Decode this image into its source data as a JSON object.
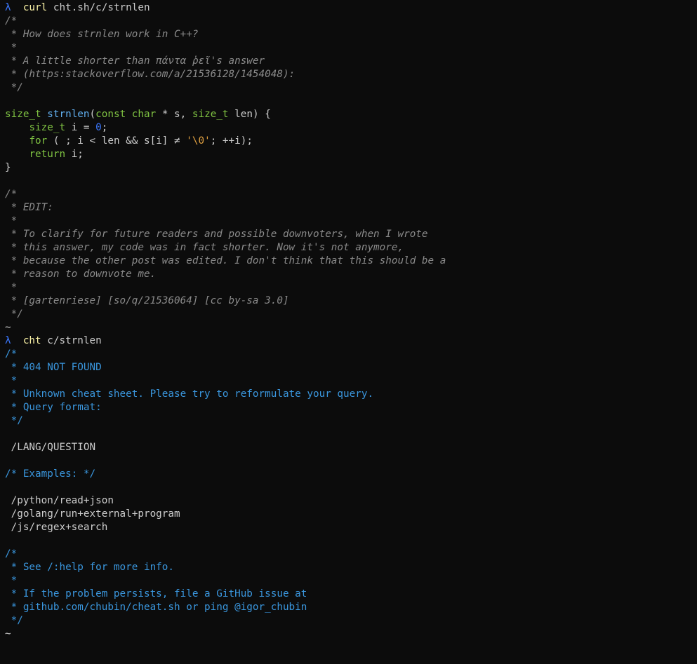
{
  "window": {
    "background": "#0c0c0c",
    "prompt_color": "#3b78ff",
    "command_color": "#f9f1a5",
    "comment_color": "#8a8a8a",
    "error_color": "#3a96dd"
  },
  "terminal": {
    "lines": [
      {
        "t": "prompt",
        "segments": [
          {
            "c": "prompt-sym",
            "x": "λ  "
          },
          {
            "c": "cmd",
            "x": "curl"
          },
          {
            "c": "arg",
            "x": " cht.sh/c/strnlen"
          }
        ]
      },
      {
        "t": "text",
        "segments": [
          {
            "c": "cmt",
            "x": "/*"
          }
        ]
      },
      {
        "t": "text",
        "segments": [
          {
            "c": "cmt",
            "x": " * How does strnlen work in C++?"
          }
        ]
      },
      {
        "t": "text",
        "segments": [
          {
            "c": "cmt",
            "x": " *"
          }
        ]
      },
      {
        "t": "text",
        "segments": [
          {
            "c": "cmt",
            "x": " * A little shorter than πάντα ῥεῖ's answer"
          }
        ]
      },
      {
        "t": "text",
        "segments": [
          {
            "c": "cmt",
            "x": " * (https:stackoverflow.com/a/21536128/1454048):"
          }
        ]
      },
      {
        "t": "text",
        "segments": [
          {
            "c": "cmt",
            "x": " */"
          }
        ]
      },
      {
        "t": "text",
        "segments": [
          {
            "c": "plain",
            "x": ""
          }
        ]
      },
      {
        "t": "code",
        "segments": [
          {
            "c": "type",
            "x": "size_t"
          },
          {
            "c": "plain",
            "x": " "
          },
          {
            "c": "fn",
            "x": "strnlen"
          },
          {
            "c": "plain",
            "x": "("
          },
          {
            "c": "kw",
            "x": "const"
          },
          {
            "c": "plain",
            "x": " "
          },
          {
            "c": "kw",
            "x": "char"
          },
          {
            "c": "plain",
            "x": " * s, "
          },
          {
            "c": "type",
            "x": "size_t"
          },
          {
            "c": "plain",
            "x": " len) {"
          }
        ]
      },
      {
        "t": "code",
        "segments": [
          {
            "c": "plain",
            "x": "    "
          },
          {
            "c": "type",
            "x": "size_t"
          },
          {
            "c": "plain",
            "x": " i = "
          },
          {
            "c": "num",
            "x": "0"
          },
          {
            "c": "plain",
            "x": ";"
          }
        ]
      },
      {
        "t": "code",
        "segments": [
          {
            "c": "plain",
            "x": "    "
          },
          {
            "c": "kw",
            "x": "for"
          },
          {
            "c": "plain",
            "x": " ( ; i < len && s[i] ≠ "
          },
          {
            "c": "str",
            "x": "'\\0'"
          },
          {
            "c": "plain",
            "x": "; ++i);"
          }
        ]
      },
      {
        "t": "code",
        "segments": [
          {
            "c": "plain",
            "x": "    "
          },
          {
            "c": "kw",
            "x": "return"
          },
          {
            "c": "plain",
            "x": " i;"
          }
        ]
      },
      {
        "t": "code",
        "segments": [
          {
            "c": "plain",
            "x": "}"
          }
        ]
      },
      {
        "t": "text",
        "segments": [
          {
            "c": "plain",
            "x": ""
          }
        ]
      },
      {
        "t": "text",
        "segments": [
          {
            "c": "cmt",
            "x": "/*"
          }
        ]
      },
      {
        "t": "text",
        "segments": [
          {
            "c": "cmt",
            "x": " * EDIT:"
          }
        ]
      },
      {
        "t": "text",
        "segments": [
          {
            "c": "cmt",
            "x": " *"
          }
        ]
      },
      {
        "t": "text",
        "segments": [
          {
            "c": "cmt",
            "x": " * To clarify for future readers and possible downvoters, when I wrote"
          }
        ]
      },
      {
        "t": "text",
        "segments": [
          {
            "c": "cmt",
            "x": " * this answer, my code was in fact shorter. Now it's not anymore,"
          }
        ]
      },
      {
        "t": "text",
        "segments": [
          {
            "c": "cmt",
            "x": " * because the other post was edited. I don't think that this should be a"
          }
        ]
      },
      {
        "t": "text",
        "segments": [
          {
            "c": "cmt",
            "x": " * reason to downvote me."
          }
        ]
      },
      {
        "t": "text",
        "segments": [
          {
            "c": "cmt",
            "x": " *"
          }
        ]
      },
      {
        "t": "text",
        "segments": [
          {
            "c": "cmt",
            "x": " * [gartenriese] [so/q/21536064] [cc by-sa 3.0]"
          }
        ]
      },
      {
        "t": "text",
        "segments": [
          {
            "c": "cmt",
            "x": " */"
          }
        ]
      },
      {
        "t": "text",
        "segments": [
          {
            "c": "plain",
            "x": "~"
          }
        ]
      },
      {
        "t": "prompt",
        "segments": [
          {
            "c": "prompt-sym",
            "x": "λ  "
          },
          {
            "c": "cmd",
            "x": "cht"
          },
          {
            "c": "arg",
            "x": " c/strnlen"
          }
        ]
      },
      {
        "t": "text",
        "segments": [
          {
            "c": "err",
            "x": "/*"
          }
        ]
      },
      {
        "t": "text",
        "segments": [
          {
            "c": "err",
            "x": " * 404 NOT FOUND"
          }
        ]
      },
      {
        "t": "text",
        "segments": [
          {
            "c": "err",
            "x": " *"
          }
        ]
      },
      {
        "t": "text",
        "segments": [
          {
            "c": "err",
            "x": " * Unknown cheat sheet. Please try to reformulate your query."
          }
        ]
      },
      {
        "t": "text",
        "segments": [
          {
            "c": "err",
            "x": " * Query format:"
          }
        ]
      },
      {
        "t": "text",
        "segments": [
          {
            "c": "err",
            "x": " */"
          }
        ]
      },
      {
        "t": "text",
        "segments": [
          {
            "c": "plain",
            "x": ""
          }
        ]
      },
      {
        "t": "text",
        "segments": [
          {
            "c": "plain",
            "x": " /LANG/QUESTION"
          }
        ]
      },
      {
        "t": "text",
        "segments": [
          {
            "c": "plain",
            "x": ""
          }
        ]
      },
      {
        "t": "text",
        "segments": [
          {
            "c": "err",
            "x": "/* Examples: */"
          }
        ]
      },
      {
        "t": "text",
        "segments": [
          {
            "c": "plain",
            "x": ""
          }
        ]
      },
      {
        "t": "text",
        "segments": [
          {
            "c": "plain",
            "x": " /python/read+json"
          }
        ]
      },
      {
        "t": "text",
        "segments": [
          {
            "c": "plain",
            "x": " /golang/run+external+program"
          }
        ]
      },
      {
        "t": "text",
        "segments": [
          {
            "c": "plain",
            "x": " /js/regex+search"
          }
        ]
      },
      {
        "t": "text",
        "segments": [
          {
            "c": "plain",
            "x": ""
          }
        ]
      },
      {
        "t": "text",
        "segments": [
          {
            "c": "err",
            "x": "/*"
          }
        ]
      },
      {
        "t": "text",
        "segments": [
          {
            "c": "err",
            "x": " * See /:help for more info."
          }
        ]
      },
      {
        "t": "text",
        "segments": [
          {
            "c": "err",
            "x": " *"
          }
        ]
      },
      {
        "t": "text",
        "segments": [
          {
            "c": "err",
            "x": " * If the problem persists, file a GitHub issue at"
          }
        ]
      },
      {
        "t": "text",
        "segments": [
          {
            "c": "err",
            "x": " * github.com/chubin/cheat.sh or ping @igor_chubin"
          }
        ]
      },
      {
        "t": "text",
        "segments": [
          {
            "c": "err",
            "x": " */"
          }
        ]
      },
      {
        "t": "text",
        "segments": [
          {
            "c": "plain",
            "x": "~"
          }
        ]
      }
    ],
    "current_prompt": {
      "symbol": "λ  ",
      "input": ""
    }
  }
}
